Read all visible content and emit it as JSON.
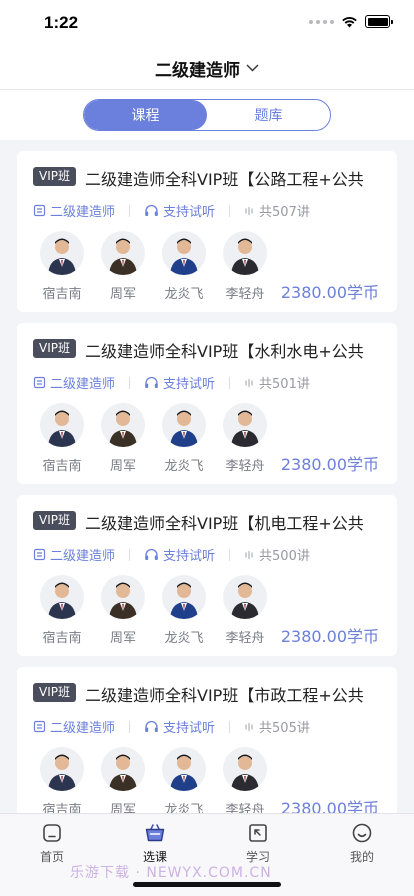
{
  "status": {
    "time": "1:22"
  },
  "header": {
    "title": "二级建造师"
  },
  "segments": [
    {
      "label": "课程"
    },
    {
      "label": "题库"
    }
  ],
  "courses": [
    {
      "badge": "VIP班",
      "title": "二级建造师全科VIP班【公路工程+公共",
      "category": "二级建造师",
      "trial": "支持试听",
      "lessons": "共507讲",
      "teachers": [
        "宿吉南",
        "周军",
        "龙炎飞",
        "李轻舟"
      ],
      "price": "2380.00学币"
    },
    {
      "badge": "VIP班",
      "title": "二级建造师全科VIP班【水利水电+公共",
      "category": "二级建造师",
      "trial": "支持试听",
      "lessons": "共501讲",
      "teachers": [
        "宿吉南",
        "周军",
        "龙炎飞",
        "李轻舟"
      ],
      "price": "2380.00学币"
    },
    {
      "badge": "VIP班",
      "title": "二级建造师全科VIP班【机电工程+公共",
      "category": "二级建造师",
      "trial": "支持试听",
      "lessons": "共500讲",
      "teachers": [
        "宿吉南",
        "周军",
        "龙炎飞",
        "李轻舟"
      ],
      "price": "2380.00学币"
    },
    {
      "badge": "VIP班",
      "title": "二级建造师全科VIP班【市政工程+公共",
      "category": "二级建造师",
      "trial": "支持试听",
      "lessons": "共505讲",
      "teachers": [
        "宿吉南",
        "周军",
        "龙炎飞",
        "李轻舟"
      ],
      "price": "2380.00学币"
    }
  ],
  "tabbar": [
    {
      "label": "首页",
      "icon": "home-icon"
    },
    {
      "label": "选课",
      "icon": "basket-icon"
    },
    {
      "label": "学习",
      "icon": "study-icon"
    },
    {
      "label": "我的",
      "icon": "profile-icon"
    }
  ],
  "watermark": "乐游下载 · NEWYX.COM.CN",
  "colors": {
    "accent": "#6b7fdc",
    "badge": "#4a4d5c",
    "background": "#f3f4f8"
  }
}
